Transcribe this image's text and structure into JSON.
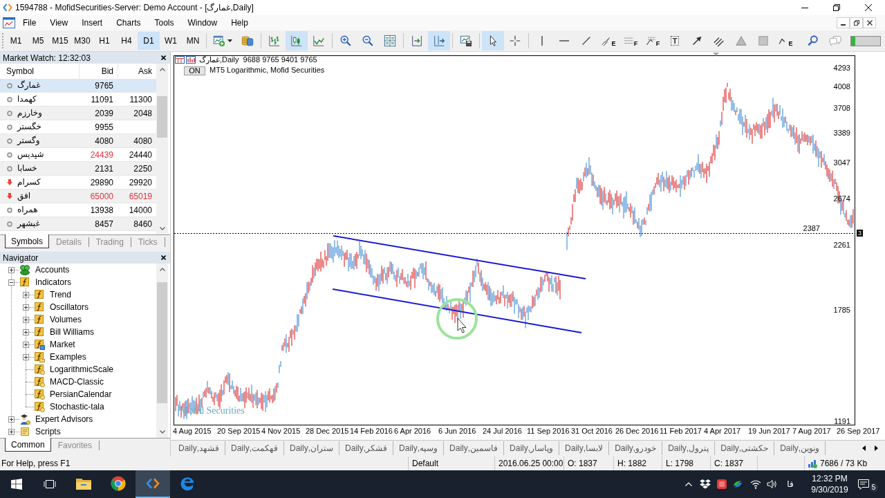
{
  "title_bar": {
    "title": "1594788 - MofidSecurities-Server: Demo Account - [غمارگ,Daily]"
  },
  "menu_bar": {
    "items": [
      "File",
      "View",
      "Insert",
      "Charts",
      "Tools",
      "Window",
      "Help"
    ]
  },
  "toolbar": {
    "timeframes": [
      {
        "label": "M1",
        "selected": false
      },
      {
        "label": "M5",
        "selected": false
      },
      {
        "label": "M15",
        "selected": false
      },
      {
        "label": "M30",
        "selected": false
      },
      {
        "label": "H1",
        "selected": false
      },
      {
        "label": "H4",
        "selected": false
      },
      {
        "label": "D1",
        "selected": true
      },
      {
        "label": "W1",
        "selected": false
      },
      {
        "label": "MN",
        "selected": false
      }
    ],
    "groups": [
      [
        {
          "kind": "new-chart",
          "selected": false
        },
        {
          "kind": "trading",
          "selected": false
        }
      ],
      [
        {
          "kind": "bar-chart",
          "selected": false
        },
        {
          "kind": "candlesticks",
          "selected": true
        },
        {
          "kind": "line-chart",
          "selected": false
        }
      ],
      [
        {
          "kind": "zoom-in",
          "selected": false
        },
        {
          "kind": "zoom-out",
          "selected": false
        },
        {
          "kind": "tile-windows",
          "selected": false
        }
      ],
      [
        {
          "kind": "chart-shift",
          "selected": false
        },
        {
          "kind": "autoscroll",
          "selected": true
        }
      ],
      [
        {
          "kind": "templates",
          "selected": false
        }
      ],
      [
        {
          "kind": "cursor",
          "selected": true
        },
        {
          "kind": "crosshair",
          "selected": false
        }
      ],
      [
        {
          "kind": "vertical-line",
          "selected": false
        },
        {
          "kind": "horizontal-line",
          "selected": false
        },
        {
          "kind": "trendline",
          "selected": false
        },
        {
          "kind": "channel",
          "badge": "E",
          "selected": false
        },
        {
          "kind": "fibo-retracement",
          "badge": "F",
          "selected": false
        },
        {
          "kind": "fibo-fan",
          "badge": "F",
          "selected": false
        },
        {
          "kind": "text",
          "badge": "T",
          "selected": false
        },
        {
          "kind": "arrow",
          "selected": false
        },
        {
          "kind": "parallel-lines",
          "selected": false
        },
        {
          "kind": "triangle",
          "selected": false
        },
        {
          "kind": "rectangle",
          "selected": false
        },
        {
          "kind": "zigzag",
          "badge": "E",
          "selected": false
        },
        {
          "kind": "search",
          "selected": false
        },
        {
          "kind": "chat",
          "selected": false
        }
      ]
    ],
    "meter": {
      "level": 0.15
    }
  },
  "market_watch": {
    "title": "Market Watch: 12:32:03",
    "columns": [
      "Symbol",
      "Bid",
      "Ask"
    ],
    "rows": [
      {
        "symbol": "غمارگ",
        "kind": "flat",
        "bid": "9765",
        "bid_down": false,
        "selected": true
      },
      {
        "symbol": "کهمدا",
        "kind": "flat",
        "bid": "11091",
        "bid_down": false,
        "ask": "11300",
        "ask_down": false,
        "selected": false
      },
      {
        "symbol": "وخارزم",
        "kind": "flat",
        "bid": "2039",
        "bid_down": false,
        "ask": "2048",
        "ask_down": false,
        "selected": false
      },
      {
        "symbol": "خگستر",
        "kind": "flat",
        "bid": "9955",
        "bid_down": false,
        "selected": false
      },
      {
        "symbol": "وگستر",
        "kind": "flat",
        "bid": "4080",
        "bid_down": false,
        "ask": "4080",
        "ask_down": false,
        "selected": false
      },
      {
        "symbol": "شپدیس",
        "kind": "flat",
        "bid": "24439",
        "bid_down": true,
        "ask": "24440",
        "ask_down": false,
        "selected": false
      },
      {
        "symbol": "خسابا",
        "kind": "flat",
        "bid": "2131",
        "bid_down": false,
        "ask": "2250",
        "ask_down": false,
        "selected": false
      },
      {
        "symbol": "کسرام",
        "kind": "down",
        "bid": "29890",
        "bid_down": false,
        "ask": "29920",
        "ask_down": false,
        "selected": false
      },
      {
        "symbol": "افق",
        "kind": "down",
        "bid": "65000",
        "bid_down": true,
        "ask": "65019",
        "ask_down": true,
        "selected": false
      },
      {
        "symbol": "همراه",
        "kind": "flat",
        "bid": "13938",
        "bid_down": false,
        "ask": "14000",
        "ask_down": false,
        "selected": false
      },
      {
        "symbol": "غبشهر",
        "kind": "flat",
        "bid": "8457",
        "bid_down": false,
        "ask": "8460",
        "ask_down": false,
        "selected": false
      }
    ],
    "tabs": [
      {
        "label": "Symbols",
        "selected": true
      },
      {
        "label": "Details",
        "selected": false
      },
      {
        "label": "Trading",
        "selected": false
      },
      {
        "label": "Ticks",
        "selected": false
      }
    ]
  },
  "navigator": {
    "title": "Navigator",
    "items": [
      {
        "label": "Accounts",
        "kind": "accounts",
        "expanded": false
      },
      {
        "label": "Indicators",
        "kind": "indicator-folder",
        "expanded": true,
        "children": [
          {
            "label": "Trend",
            "kind": "indicator-folder",
            "expanded": false
          },
          {
            "label": "Oscillators",
            "kind": "indicator-folder",
            "expanded": false
          },
          {
            "label": "Volumes",
            "kind": "indicator-folder",
            "expanded": false
          },
          {
            "label": "Bill Williams",
            "kind": "indicator-folder",
            "expanded": false
          },
          {
            "label": "Market",
            "kind": "market",
            "expanded": false
          },
          {
            "label": "Examples",
            "kind": "examples",
            "expanded": false
          },
          {
            "label": "LogarithmicScale",
            "kind": "indicator"
          },
          {
            "label": "MACD-Classic",
            "kind": "indicator"
          },
          {
            "label": "PersianCalendar",
            "kind": "indicator"
          },
          {
            "label": "Stochastic-tala",
            "kind": "indicator"
          }
        ]
      },
      {
        "label": "Expert Advisors",
        "kind": "expert-advisors",
        "expanded": false
      },
      {
        "label": "Scripts",
        "kind": "scripts",
        "expanded": false
      }
    ],
    "tabs": [
      {
        "label": "Common",
        "selected": true
      },
      {
        "label": "Favorites",
        "selected": false
      }
    ]
  },
  "chart": {
    "header": {
      "symbol_line": "غمارگ,Daily  9688 9765 9401 9765",
      "toggle": "ON",
      "indicator": "MT5 Logarithmic, Mofid Securities"
    },
    "price_labels": [
      "4293",
      "4008",
      "3708",
      "3389",
      "3047",
      "2674",
      "2261",
      "1785",
      "1191"
    ],
    "line_label": "2387",
    "line_marker": "3",
    "time_labels": [
      "4 Aug 2015",
      "20 Sep 2015",
      "4 Nov 2015",
      "28 Dec 2015",
      "14 Feb 2016",
      "6 Apr 2016",
      "6 Jun 2016",
      "24 Jul 2016",
      "11 Sep 2016",
      "31 Oct 2016",
      "26 Dec 2016",
      "11 Feb 2017",
      "4 Apr 2017",
      "19 Jun 2017",
      "7 Aug 2017",
      "26 Sep 2017"
    ],
    "logo": "Mofid Securities"
  },
  "chart_tabs": [
    {
      "label": "قشهد,Daily",
      "selected": false
    },
    {
      "label": "قهکمت,Daily",
      "selected": false
    },
    {
      "label": "ستران,Daily",
      "selected": false
    },
    {
      "label": "قشکر,Daily",
      "selected": false
    },
    {
      "label": "وسپه,Daily",
      "selected": false
    },
    {
      "label": "فاسمین,Daily",
      "selected": false
    },
    {
      "label": "وپاسار,Daily",
      "selected": false
    },
    {
      "label": "لابسا,Daily",
      "selected": false
    },
    {
      "label": "خودرو,Daily",
      "selected": false
    },
    {
      "label": "پترول,Daily",
      "selected": false
    },
    {
      "label": "حکشتی,Daily",
      "selected": false
    },
    {
      "label": "ونوین,Daily",
      "selected": false
    }
  ],
  "status_bar": {
    "help": "For Help, press F1",
    "profile": "Default",
    "datetime": "2016.06.25 00:00",
    "open": "O: 1837",
    "high": "H: 1882",
    "low": "L: 1798",
    "close": "C: 1837",
    "traffic": "7686 / 73 Kb"
  },
  "taskbar": {
    "apps": [
      {
        "kind": "file-explorer",
        "active": false
      },
      {
        "kind": "chrome",
        "active": false
      },
      {
        "kind": "metatrader",
        "active": true
      },
      {
        "kind": "edge",
        "active": false
      }
    ],
    "language": "فا",
    "time": "12:32 PM",
    "date": "9/30/2019",
    "notification_count": "5"
  }
}
